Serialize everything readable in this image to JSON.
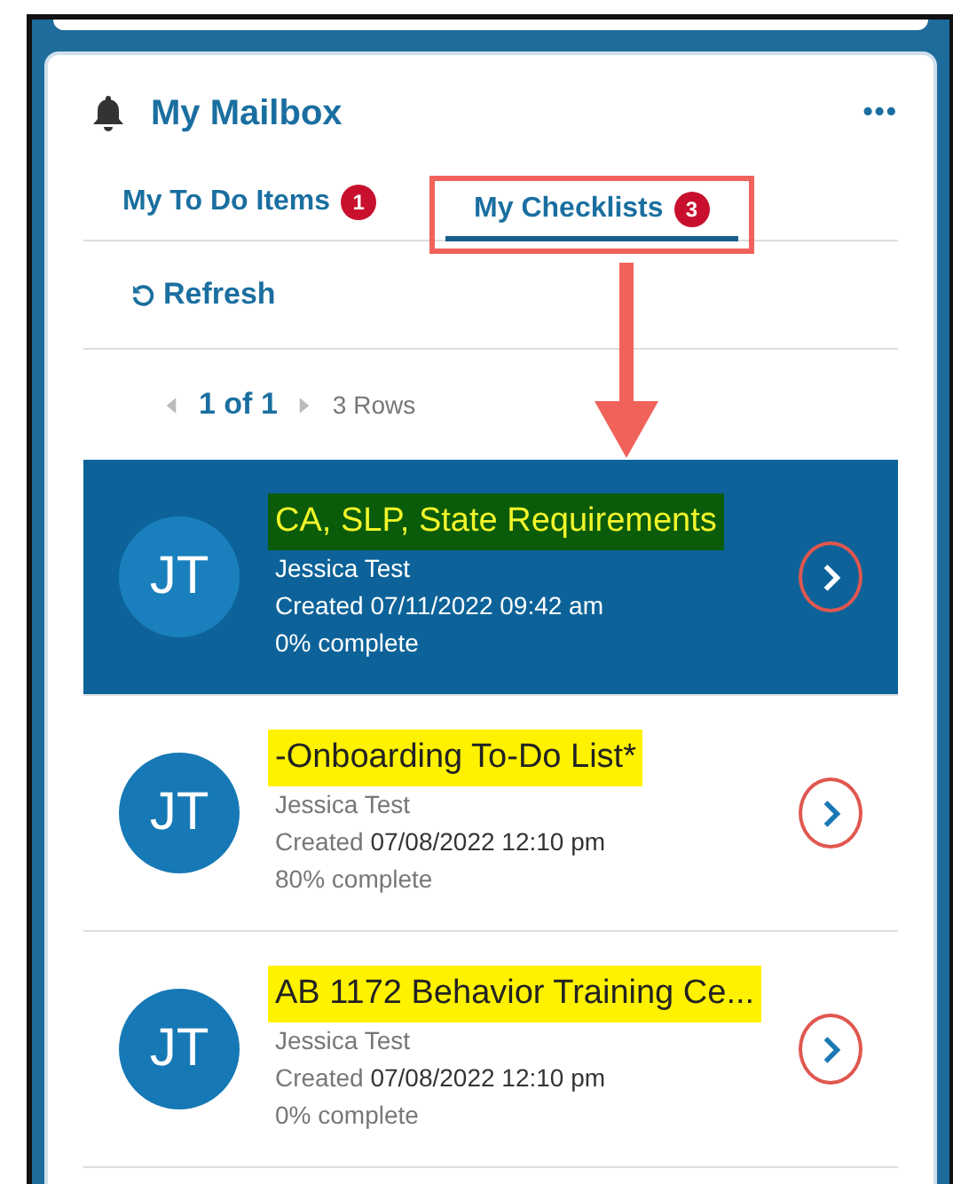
{
  "header": {
    "title": "My Mailbox",
    "more": "•••"
  },
  "tabs": [
    {
      "label": "My To Do Items",
      "count": "1",
      "selected": false,
      "annotated": false
    },
    {
      "label": "My Checklists",
      "count": "3",
      "selected": true,
      "annotated": true
    }
  ],
  "refresh": {
    "label": "Refresh"
  },
  "pager": {
    "page": "1 of 1",
    "rows": "3 Rows"
  },
  "checklists": [
    {
      "initials": "JT",
      "title": "CA, SLP, State Requirements",
      "color": "#0a5c0a",
      "owner": "Jessica Test",
      "created_label": "Created",
      "created_at": "07/11/2022 09:42 am",
      "progress": "0% complete",
      "selected": true
    },
    {
      "initials": "JT",
      "title": "-Onboarding To-Do List*",
      "color": "#fff200",
      "owner": "Jessica Test",
      "created_label": "Created",
      "created_at": "07/08/2022 12:10 pm",
      "progress": "80% complete",
      "selected": false
    },
    {
      "initials": "JT",
      "title": "AB 1172 Behavior Training Ce...",
      "color": "#fff200",
      "owner": "Jessica Test",
      "created_label": "Created",
      "created_at": "07/08/2022 12:10 pm",
      "progress": "0% complete",
      "selected": false
    }
  ]
}
